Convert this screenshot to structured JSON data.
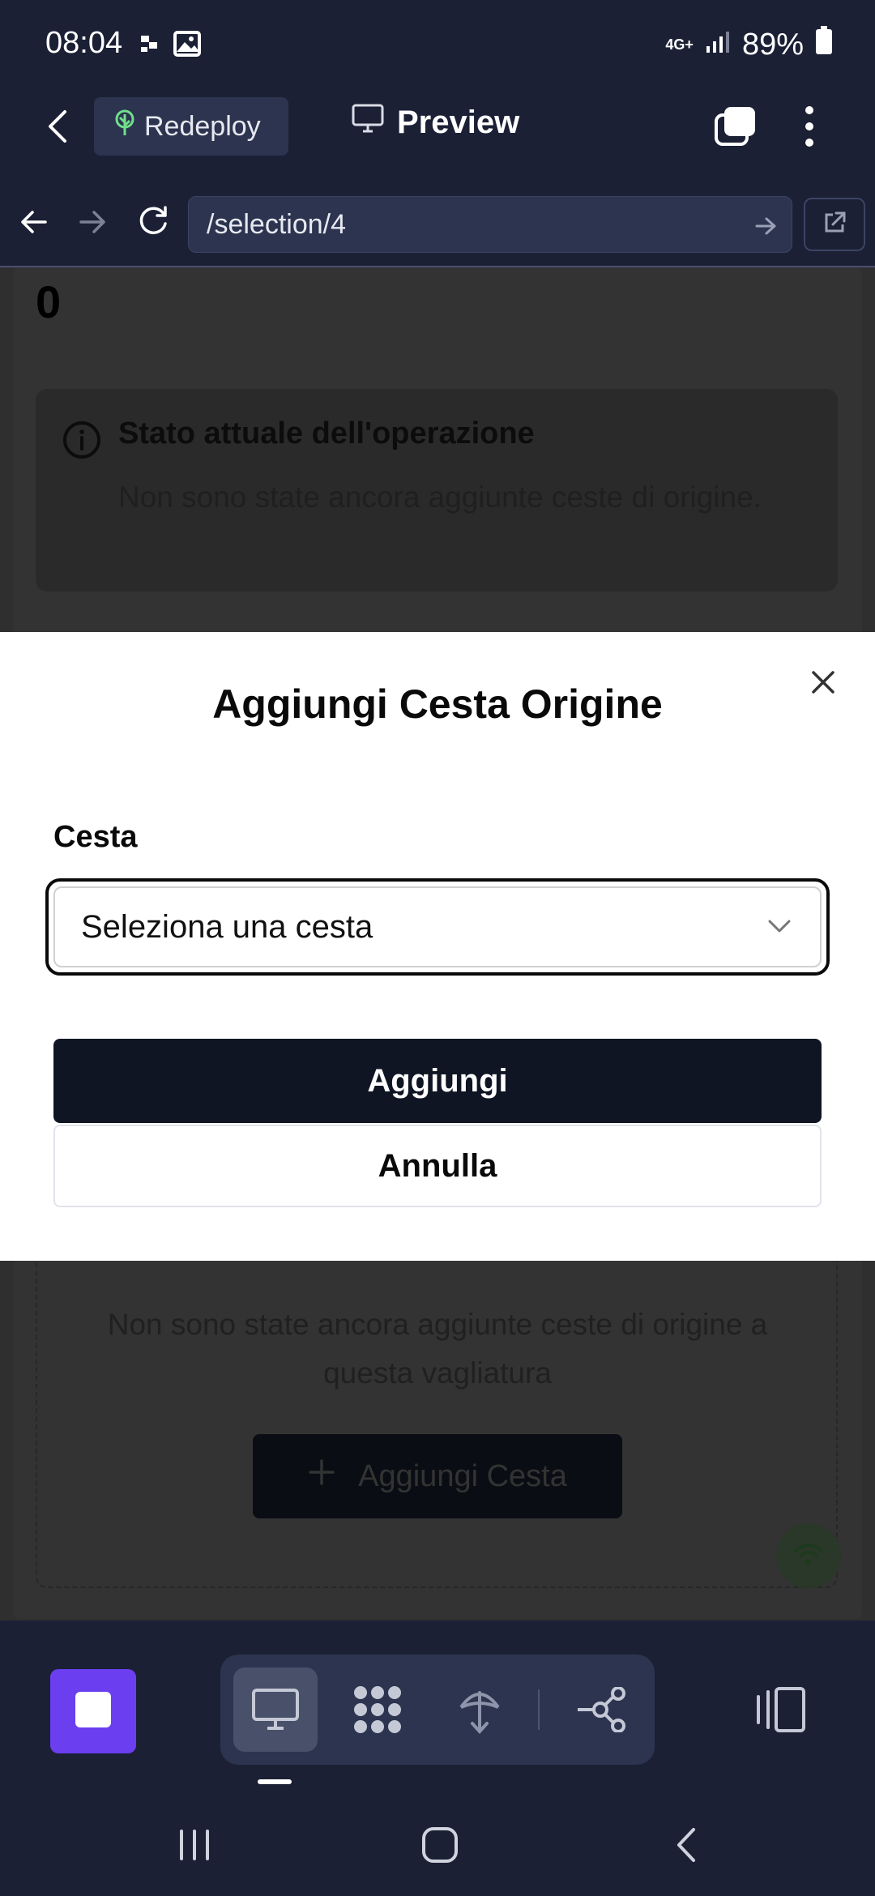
{
  "status_bar": {
    "time": "08:04",
    "network": "4G+",
    "battery": "89%"
  },
  "header": {
    "redeploy_label": "Redeploy",
    "preview_label": "Preview"
  },
  "browser": {
    "url": "/selection/4"
  },
  "page": {
    "counter": "0",
    "info_title": "Stato attuale dell'operazione",
    "info_text": "Non sono state ancora aggiunte ceste di origine.",
    "empty_text": "Non sono state ancora aggiunte ceste di origine a questa vagliatura",
    "add_basket_label": "Aggiungi Cesta"
  },
  "modal": {
    "title": "Aggiungi Cesta Origine",
    "field_label": "Cesta",
    "select_placeholder": "Seleziona una cesta",
    "primary_label": "Aggiungi",
    "secondary_label": "Annulla"
  },
  "colors": {
    "accent": "#6b3ff0",
    "app_bg": "#1b2035",
    "primary_button": "#0f1523"
  }
}
